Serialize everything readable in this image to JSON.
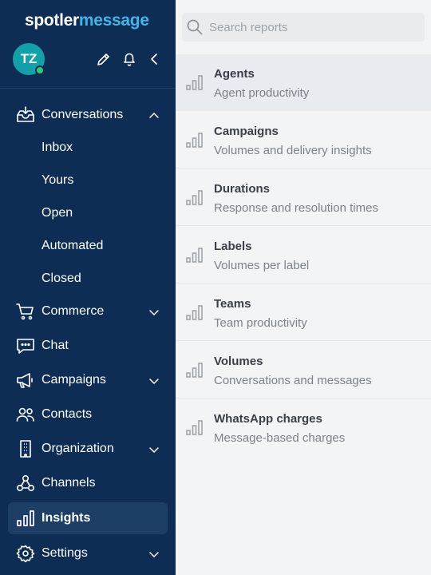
{
  "brand": {
    "part1": "spotler",
    "part2": "message"
  },
  "user": {
    "initials": "TZ",
    "online": true
  },
  "topbar": {
    "icons": [
      "pencil-icon",
      "bell-icon",
      "collapse-chevron-icon"
    ]
  },
  "nav": {
    "conversations": {
      "label": "Conversations",
      "expanded": true,
      "children": [
        "Inbox",
        "Yours",
        "Open",
        "Automated",
        "Closed"
      ]
    },
    "commerce": {
      "label": "Commerce"
    },
    "chat": {
      "label": "Chat"
    },
    "campaigns": {
      "label": "Campaigns"
    },
    "contacts": {
      "label": "Contacts"
    },
    "organization": {
      "label": "Organization"
    },
    "channels": {
      "label": "Channels"
    },
    "insights": {
      "label": "Insights",
      "active": true
    },
    "settings": {
      "label": "Settings"
    }
  },
  "search": {
    "placeholder": "Search reports",
    "value": ""
  },
  "reports": [
    {
      "title": "Agents",
      "subtitle": "Agent productivity",
      "selected": true
    },
    {
      "title": "Campaigns",
      "subtitle": "Volumes and delivery insights"
    },
    {
      "title": "Durations",
      "subtitle": "Response and resolution times"
    },
    {
      "title": "Labels",
      "subtitle": "Volumes per label"
    },
    {
      "title": "Teams",
      "subtitle": "Team productivity"
    },
    {
      "title": "Volumes",
      "subtitle": "Conversations and messages"
    },
    {
      "title": "WhatsApp charges",
      "subtitle": "Message-based charges"
    }
  ],
  "colors": {
    "sidebar_bg": "#0d2d55",
    "sidebar_active": "#1d3f66",
    "brand_accent": "#3fb6e8",
    "avatar": "#12a1a8",
    "online": "#2ecc71"
  }
}
